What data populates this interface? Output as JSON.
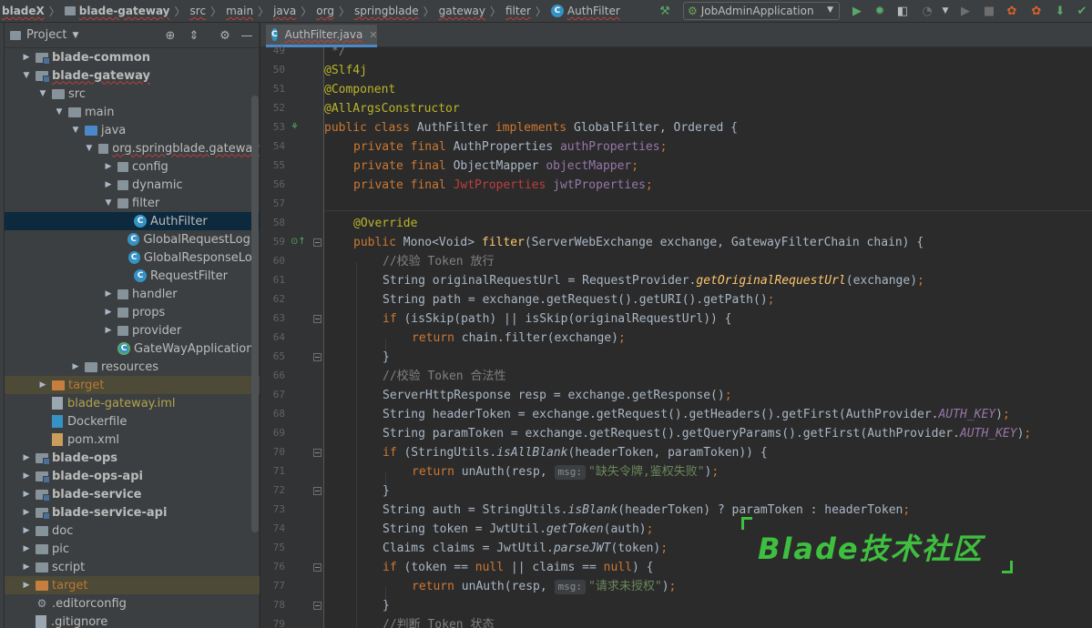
{
  "breadcrumbs": [
    "bladeX",
    "blade-gateway",
    "src",
    "main",
    "java",
    "org",
    "springblade",
    "gateway",
    "filter",
    "AuthFilter"
  ],
  "run_config": {
    "label": "JobAdminApplication"
  },
  "project_panel": {
    "title": "Project",
    "tree": [
      {
        "label": "blade-common",
        "indent": 1,
        "toggle": "▶",
        "icon": "module-folder-icon",
        "style": "bold"
      },
      {
        "label": "blade-gateway",
        "indent": 1,
        "toggle": "▼",
        "icon": "module-folder-icon",
        "style": "bold"
      },
      {
        "label": "src",
        "indent": 2,
        "toggle": "▼",
        "icon": "folder-icon",
        "style": ""
      },
      {
        "label": "main",
        "indent": 3,
        "toggle": "▼",
        "icon": "folder-icon",
        "style": ""
      },
      {
        "label": "java",
        "indent": 4,
        "toggle": "▼",
        "icon": "source-folder-icon",
        "style": ""
      },
      {
        "label": "org.springblade.gateway",
        "indent": 5,
        "toggle": "▼",
        "icon": "package-icon",
        "style": ""
      },
      {
        "label": "config",
        "indent": 6,
        "toggle": "▶",
        "icon": "package-icon",
        "style": ""
      },
      {
        "label": "dynamic",
        "indent": 6,
        "toggle": "▶",
        "icon": "package-icon",
        "style": ""
      },
      {
        "label": "filter",
        "indent": 6,
        "toggle": "▼",
        "icon": "package-icon",
        "style": ""
      },
      {
        "label": "AuthFilter",
        "indent": 7,
        "toggle": "",
        "icon": "class-icon",
        "style": "selected"
      },
      {
        "label": "GlobalRequestLogFi",
        "indent": 7,
        "toggle": "",
        "icon": "class-icon",
        "style": ""
      },
      {
        "label": "GlobalResponseLog",
        "indent": 7,
        "toggle": "",
        "icon": "class-icon",
        "style": ""
      },
      {
        "label": "RequestFilter",
        "indent": 7,
        "toggle": "",
        "icon": "class-icon",
        "style": ""
      },
      {
        "label": "handler",
        "indent": 6,
        "toggle": "▶",
        "icon": "package-icon",
        "style": ""
      },
      {
        "label": "props",
        "indent": 6,
        "toggle": "▶",
        "icon": "package-icon",
        "style": ""
      },
      {
        "label": "provider",
        "indent": 6,
        "toggle": "▶",
        "icon": "package-icon",
        "style": ""
      },
      {
        "label": "GateWayApplication",
        "indent": 6,
        "toggle": "",
        "icon": "spring-class-icon",
        "style": ""
      },
      {
        "label": "resources",
        "indent": 4,
        "toggle": "▶",
        "icon": "resources-folder-icon",
        "style": ""
      },
      {
        "label": "target",
        "indent": 2,
        "toggle": "▶",
        "icon": "excluded-folder-icon",
        "style": "excluded"
      },
      {
        "label": "blade-gateway.iml",
        "indent": 2,
        "toggle": "",
        "icon": "iml-file-icon",
        "style": "olive"
      },
      {
        "label": "Dockerfile",
        "indent": 2,
        "toggle": "",
        "icon": "docker-file-icon",
        "style": ""
      },
      {
        "label": "pom.xml",
        "indent": 2,
        "toggle": "",
        "icon": "maven-file-icon",
        "style": ""
      },
      {
        "label": "blade-ops",
        "indent": 1,
        "toggle": "▶",
        "icon": "module-folder-icon",
        "style": "bold"
      },
      {
        "label": "blade-ops-api",
        "indent": 1,
        "toggle": "▶",
        "icon": "module-folder-icon",
        "style": "bold"
      },
      {
        "label": "blade-service",
        "indent": 1,
        "toggle": "▶",
        "icon": "module-folder-icon",
        "style": "bold"
      },
      {
        "label": "blade-service-api",
        "indent": 1,
        "toggle": "▶",
        "icon": "module-folder-icon",
        "style": "bold"
      },
      {
        "label": "doc",
        "indent": 1,
        "toggle": "▶",
        "icon": "folder-icon",
        "style": ""
      },
      {
        "label": "pic",
        "indent": 1,
        "toggle": "▶",
        "icon": "folder-icon",
        "style": ""
      },
      {
        "label": "script",
        "indent": 1,
        "toggle": "▶",
        "icon": "folder-icon",
        "style": ""
      },
      {
        "label": "target",
        "indent": 1,
        "toggle": "▶",
        "icon": "excluded-folder-icon",
        "style": "excluded"
      },
      {
        "label": ".editorconfig",
        "indent": 1,
        "toggle": "",
        "icon": "gear-file-icon",
        "style": ""
      },
      {
        "label": ".gitignore",
        "indent": 1,
        "toggle": "",
        "icon": "git-file-icon",
        "style": ""
      }
    ]
  },
  "editor": {
    "tab_label": "AuthFilter.java",
    "line_numbers": [
      "49",
      "50",
      "51",
      "52",
      "53",
      "54",
      "55",
      "56",
      "57",
      "58",
      "59",
      "60",
      "61",
      "62",
      "63",
      "64",
      "65",
      "66",
      "67",
      "68",
      "69",
      "70",
      "71",
      "72",
      "73",
      "74",
      "75",
      "76",
      "77",
      "78",
      "79"
    ],
    "code": {
      "l49": "*/",
      "l50": "@Slf4j",
      "l51": "@Component",
      "l52": "@AllArgsConstructor",
      "l53_kw": "public class",
      "l53_name": " AuthFilter ",
      "l53_impl": "implements",
      "l53_rest": " GlobalFilter, Ordered {",
      "l54_kw": "private final",
      "l54_type": " AuthProperties ",
      "l54_fld": "authProperties",
      "l55_kw": "private final",
      "l55_type": " ObjectMapper ",
      "l55_fld": "objectMapper",
      "l56_kw": "private final",
      "l56_type": " JwtProperties",
      "l56_fld": "jwtProperties",
      "l58": "@Override",
      "l59_kw": "public",
      "l59_ret": " Mono<Void> ",
      "l59_name": "filter",
      "l59_params": "(ServerWebExchange exchange, GatewayFilterChain chain) {",
      "l60": "//校验 Token 放行",
      "l61_a": "String originalRequestUrl = RequestProvider.",
      "l61_m": "getOriginalRequestUrl",
      "l61_b": "(exchange)",
      "l62": "String path = exchange.getRequest().getURI().getPath()",
      "l63_kw": "if",
      "l63_rest": " (isSkip(path) || isSkip(originalRequestUrl)) {",
      "l64_kw": "return",
      "l64_rest": " chain.filter(exchange)",
      "l66": "//校验 Token 合法性",
      "l67": "ServerHttpResponse resp = exchange.getResponse()",
      "l68_a": "String headerToken = exchange.getRequest().getHeaders().getFirst(AuthProvider.",
      "l68_c": "AUTH_KEY",
      "l69_a": "String paramToken = exchange.getRequest().getQueryParams().getFirst(AuthProvider.",
      "l69_c": "AUTH_KEY",
      "l70_kw": "if",
      "l70_a": " (StringUtils.",
      "l70_m": "isAllBlank",
      "l70_b": "(headerToken, paramToken)) {",
      "l71_kw": "return",
      "l71_a": " unAuth(resp, ",
      "l71_hint": "msg:",
      "l71_str": "\"缺失令牌,鉴权失败\"",
      "l73_a": "String auth = StringUtils.",
      "l73_m": "isBlank",
      "l73_b": "(headerToken) ? paramToken : headerToken",
      "l74_a": "String token = JwtUtil.",
      "l74_m": "getToken",
      "l74_b": "(auth)",
      "l75_a": "Claims claims = JwtUtil.",
      "l75_m": "parseJWT",
      "l75_b": "(token)",
      "l76_kw": "if",
      "l76_a": " (token == ",
      "l76_null1": "null",
      "l76_b": " || claims == ",
      "l76_null2": "null",
      "l76_c": ") {",
      "l77_kw": "return",
      "l77_a": " unAuth(resp, ",
      "l77_hint": "msg:",
      "l77_str": "\"请求未授权\"",
      "l79": "//判断 Token 状态"
    }
  },
  "watermark": "Blade技术社区",
  "colors": {
    "keyword": "#cc7832",
    "annotation": "#bbb529",
    "field": "#9876aa",
    "method": "#ffc66d",
    "comment": "#808080",
    "string": "#6a8759",
    "watermark": "#3fbf3f"
  }
}
